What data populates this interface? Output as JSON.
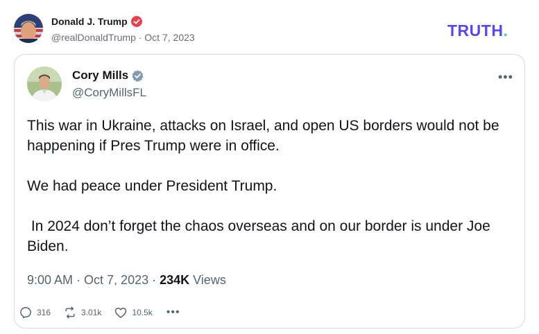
{
  "outer_post": {
    "display_name": "Donald J. Trump",
    "handle_and_date": "@realDonaldTrump · Oct 7, 2023",
    "brand_logo_text": "TRUTH",
    "brand_logo_dot": ".",
    "colors": {
      "brand": "#5448ee",
      "brand_dot": "#3ec7b4",
      "verified": "#e8424f"
    }
  },
  "embedded_tweet": {
    "display_name": "Cory Mills",
    "handle": "@CoryMillsFL",
    "more_label": "•••",
    "paragraphs": [
      "This war in Ukraine, attacks on Israel, and open US borders would not be happening if Pres Trump were in office.",
      "We had peace under President Trump.",
      " In 2024 don’t forget the chaos overseas and on our border is under Joe Biden."
    ],
    "timestamp": "9:00 AM · Oct 7, 2023 · ",
    "views_count": "234K",
    "views_label": " Views",
    "actions": {
      "replies": "316",
      "reposts": "3.01k",
      "likes": "10.5k",
      "more_label": "•••"
    },
    "colors": {
      "verified": "#829aab",
      "secondary_text": "#536471",
      "border": "#cfd9de"
    }
  }
}
